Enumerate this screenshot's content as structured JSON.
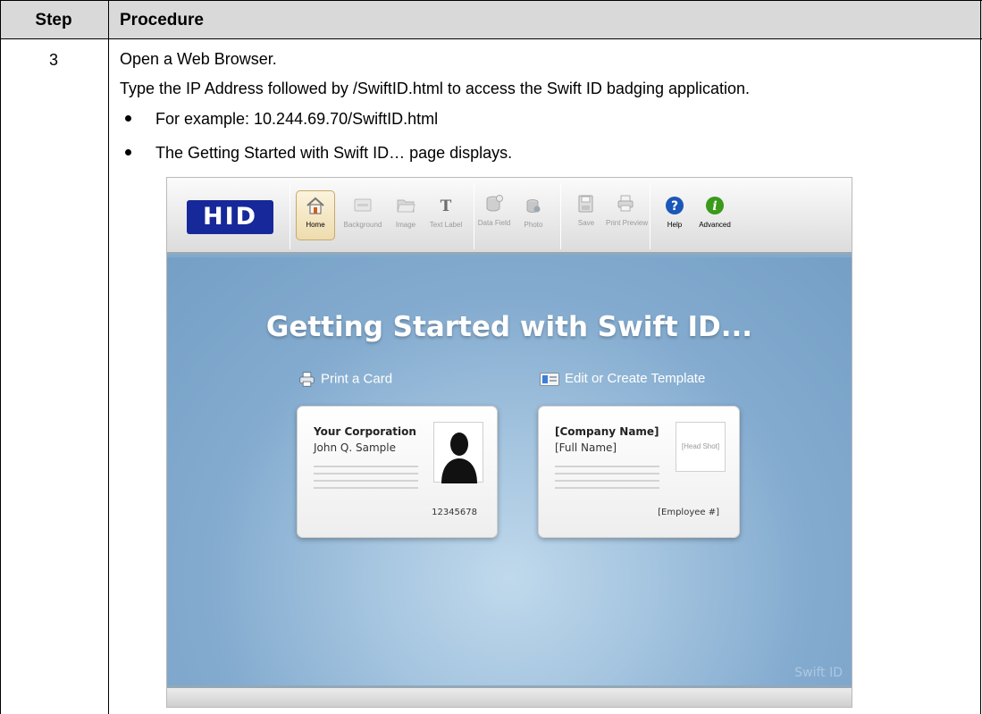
{
  "table": {
    "header_step": "Step",
    "header_procedure": "Procedure",
    "step_number": "3",
    "line1": "Open a Web Browser.",
    "line2": "Type the IP Address followed by /SwiftID.html to access the Swift ID badging application.",
    "bullet1": "For example:  10.244.69.70/SwiftID.html",
    "bullet2": "The Getting Started with Swift ID… page displays."
  },
  "app": {
    "logo": "HID",
    "toolbar": [
      {
        "id": "home",
        "label": "Home",
        "icon": "home-icon",
        "state": "active"
      },
      {
        "id": "background",
        "label": "Background",
        "icon": "background-icon",
        "state": "disabled"
      },
      {
        "id": "image",
        "label": "Image",
        "icon": "folder-icon",
        "state": "disabled"
      },
      {
        "id": "text-label",
        "label": "Text Label",
        "icon": "text-icon",
        "state": "disabled"
      },
      {
        "id": "data-field",
        "label": "Data Field",
        "icon": "database-icon",
        "state": "disabled"
      },
      {
        "id": "photo",
        "label": "Photo",
        "icon": "photo-icon",
        "state": "disabled"
      },
      {
        "id": "save",
        "label": "Save",
        "icon": "floppy-icon",
        "state": "disabled"
      },
      {
        "id": "print-preview",
        "label": "Print Preview",
        "icon": "printer-icon",
        "state": "disabled"
      },
      {
        "id": "help",
        "label": "Help",
        "icon": "help-icon",
        "state": "enabled"
      },
      {
        "id": "advanced",
        "label": "Advanced",
        "icon": "info-icon",
        "state": "enabled"
      }
    ],
    "title": "Getting Started with Swift ID...",
    "print_card_label": "Print a Card",
    "edit_template_label": "Edit or Create Template",
    "sample_card": {
      "company": "Your Corporation",
      "name": "John Q. Sample",
      "number": "12345678"
    },
    "template_card": {
      "company": "[Company Name]",
      "name": "[Full Name]",
      "headshot": "[Head Shot]",
      "employee": "[Employee #]"
    },
    "watermark": "Swift ID",
    "colors": {
      "logo_blue": "#17289a",
      "canvas_blue": "#83abcf",
      "help_blue": "#1b57b8",
      "advanced_green": "#3a9a1a"
    }
  }
}
